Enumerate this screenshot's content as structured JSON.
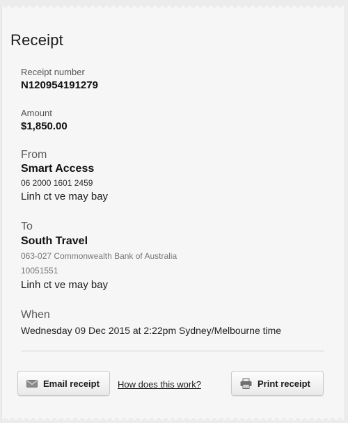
{
  "receipt": {
    "title": "Receipt",
    "receipt_number_label": "Receipt number",
    "receipt_number": "N120954191279",
    "amount_label": "Amount",
    "amount": "$1,850.00",
    "from": {
      "label": "From",
      "name": "Smart Access",
      "account": "06 2000 1601 2459",
      "description": "Linh ct ve may bay"
    },
    "to": {
      "label": "To",
      "name": "South Travel",
      "bank": "063-027 Commonwealth Bank of Australia",
      "account": "10051551",
      "description": "Linh ct ve may bay"
    },
    "when": {
      "label": "When",
      "value": "Wednesday 09 Dec 2015 at 2:22pm Sydney/Melbourne time"
    }
  },
  "actions": {
    "email_label": "Email receipt",
    "help_link": "How does this work?",
    "print_label": "Print receipt"
  },
  "icons": {
    "email": "envelope-icon",
    "print": "printer-icon"
  }
}
